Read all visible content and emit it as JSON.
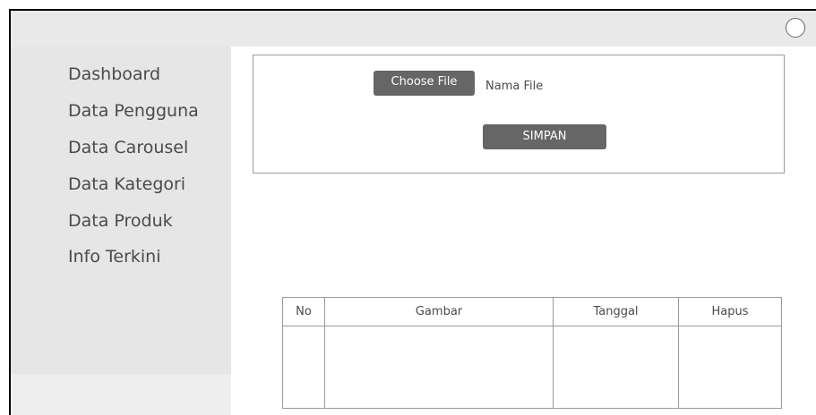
{
  "sidebar": {
    "items": [
      {
        "label": "Dashboard"
      },
      {
        "label": "Data Pengguna"
      },
      {
        "label": "Data Carousel"
      },
      {
        "label": "Data Kategori"
      },
      {
        "label": "Data Produk"
      },
      {
        "label": "Info Terkini"
      }
    ]
  },
  "upload": {
    "choose_file_label": "Choose File",
    "file_name": "Nama File",
    "save_label": "SIMPAN"
  },
  "table": {
    "columns": [
      "No",
      "Gambar",
      "Tanggal",
      "Hapus"
    ],
    "rows": []
  },
  "icons": {
    "profile": "user-avatar-icon"
  }
}
